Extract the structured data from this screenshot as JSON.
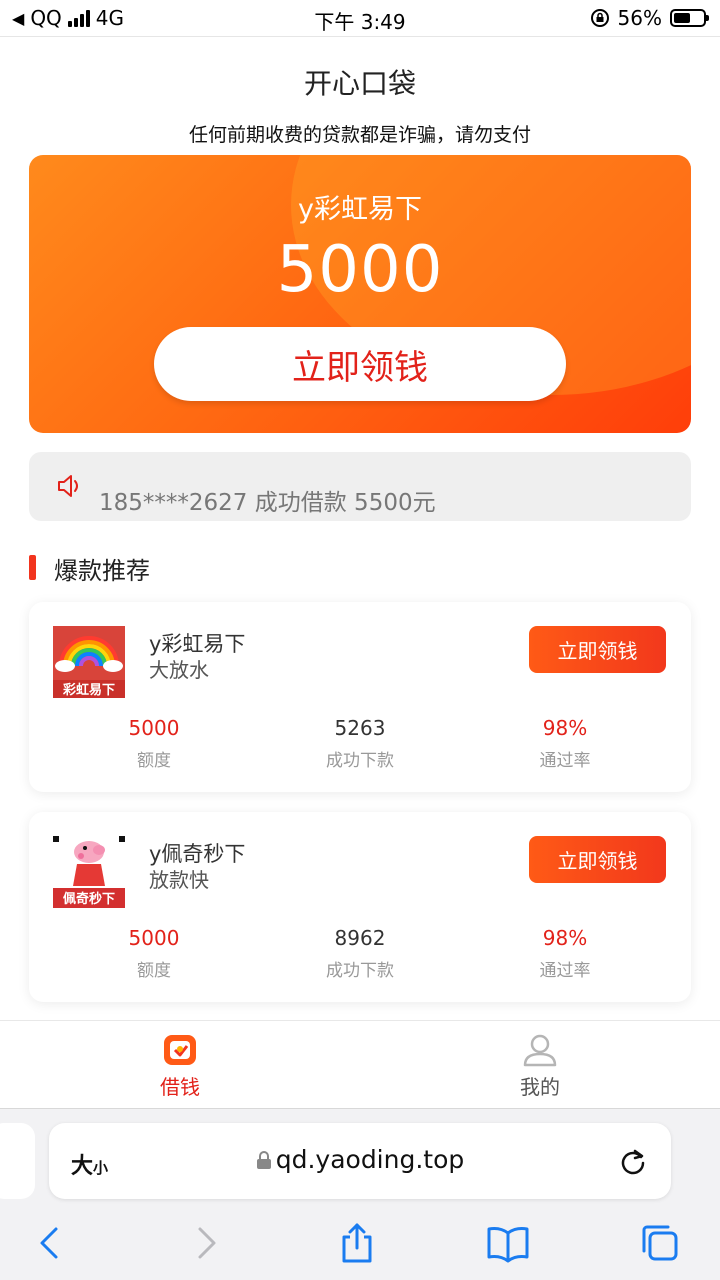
{
  "status_bar": {
    "carrier_back": "QQ",
    "network": "4G",
    "time": "下午 3:49",
    "battery_pct": "56%",
    "battery_level": 0.56
  },
  "header": {
    "title": "开心口袋",
    "warning": "任何前期收费的贷款都是诈骗，请勿支付"
  },
  "hero": {
    "product_name": "y彩虹易下",
    "amount": "5000",
    "button_label": "立即领钱"
  },
  "notice": {
    "text": "185****2627 成功借款 5500元"
  },
  "section": {
    "title": "爆款推荐"
  },
  "products": [
    {
      "name": "y彩虹易下",
      "desc": "大放水",
      "logo_text": "彩虹易下",
      "button_label": "立即领钱",
      "amount": "5000",
      "amount_label": "额度",
      "success": "5263",
      "success_label": "成功下款",
      "rate": "98%",
      "rate_label": "通过率"
    },
    {
      "name": "y佩奇秒下",
      "desc": "放款快",
      "logo_text": "佩奇秒下",
      "button_label": "立即领钱",
      "amount": "5000",
      "amount_label": "额度",
      "success": "8962",
      "success_label": "成功下款",
      "rate": "98%",
      "rate_label": "通过率"
    }
  ],
  "tabbar": {
    "borrow": "借钱",
    "mine": "我的"
  },
  "browser": {
    "text_size_big": "大",
    "text_size_small": "小",
    "url": "qd.yaoding.top",
    "accent": "#1a7cf0"
  },
  "colors": {
    "brand_red": "#e2221a",
    "hero_orange": "#ff6a12"
  }
}
